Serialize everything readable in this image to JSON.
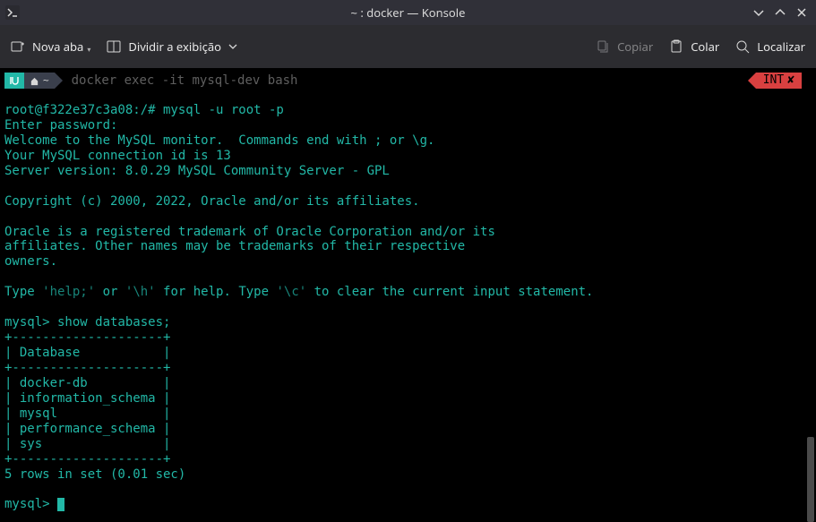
{
  "titlebar": {
    "title": "~ : docker — Konsole"
  },
  "toolbar": {
    "newTab": "Nova aba",
    "split": "Dividir a exibição",
    "copy": "Copiar",
    "paste": "Colar",
    "find": "Localizar"
  },
  "prompt": {
    "path": "~",
    "command": "docker exec -it mysql-dev bash",
    "badge": "INT"
  },
  "lines": {
    "l1": "root@f322e37c3a08:/# mysql -u root -p",
    "l2": "Enter password:",
    "l3": "Welcome to the MySQL monitor.  Commands end with ; or \\g.",
    "l4": "Your MySQL connection id is 13",
    "l5": "Server version: 8.0.29 MySQL Community Server - GPL",
    "l6": "Copyright (c) 2000, 2022, Oracle and/or its affiliates.",
    "l7": "Oracle is a registered trademark of Oracle Corporation and/or its",
    "l8": "affiliates. Other names may be trademarks of their respective",
    "l9": "owners.",
    "l10a": "Type ",
    "l10b": "'help;'",
    "l10c": " or ",
    "l10d": "'\\h'",
    "l10e": " for help. Type ",
    "l10f": "'\\c'",
    "l10g": " to clear the current input statement.",
    "l11": "mysql> show databases;",
    "l12": "+--------------------+",
    "l13": "| Database           |",
    "l14": "+--------------------+",
    "l15": "| docker-db          |",
    "l16": "| information_schema |",
    "l17": "| mysql              |",
    "l18": "| performance_schema |",
    "l19": "| sys                |",
    "l20": "+--------------------+",
    "l21": "5 rows in set (0.01 sec)",
    "l22": "mysql> "
  }
}
